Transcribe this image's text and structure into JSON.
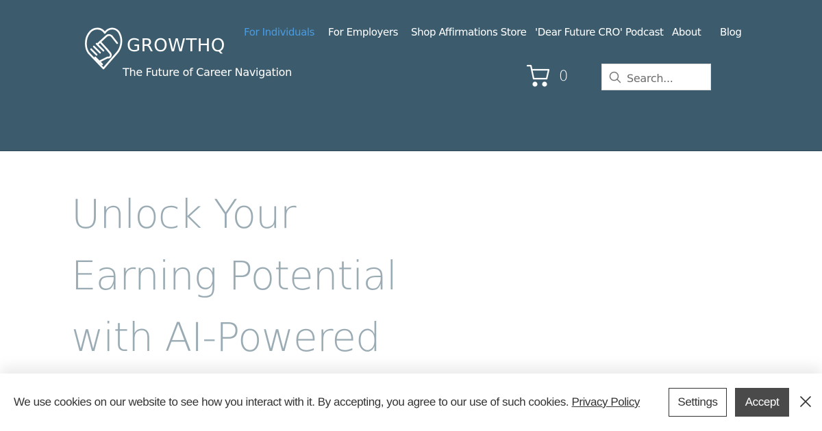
{
  "header": {
    "brand_name": "GROWTHQ",
    "tagline": "The Future of Career Navigation",
    "background_color": "#3c5c6e",
    "logo_icon": "heart-handshake-icon"
  },
  "nav": {
    "items": [
      {
        "label": "For Individuals",
        "active": true
      },
      {
        "label": "For Employers",
        "active": false
      },
      {
        "label": "Shop Affirmations Store",
        "active": false
      },
      {
        "label": "'Dear Future CRO' Podcast",
        "active": false
      },
      {
        "label": "About",
        "active": false
      },
      {
        "label": "Blog",
        "active": false
      }
    ],
    "active_color": "#4a9be0"
  },
  "cart": {
    "icon": "shopping-cart-icon",
    "count": "0"
  },
  "search": {
    "icon": "search-icon",
    "placeholder": "Search...",
    "value": ""
  },
  "hero": {
    "title_lines": [
      "Unlock Your",
      "Earning Potential",
      "with AI-Powered"
    ],
    "color": "#9aabb4"
  },
  "cookie_banner": {
    "message": "We use cookies on our website to see how you interact with it. By accepting, you agree to our use of such cookies.",
    "link_label": "Privacy Policy",
    "settings_label": "Settings",
    "accept_label": "Accept",
    "close_icon": "close-icon"
  }
}
